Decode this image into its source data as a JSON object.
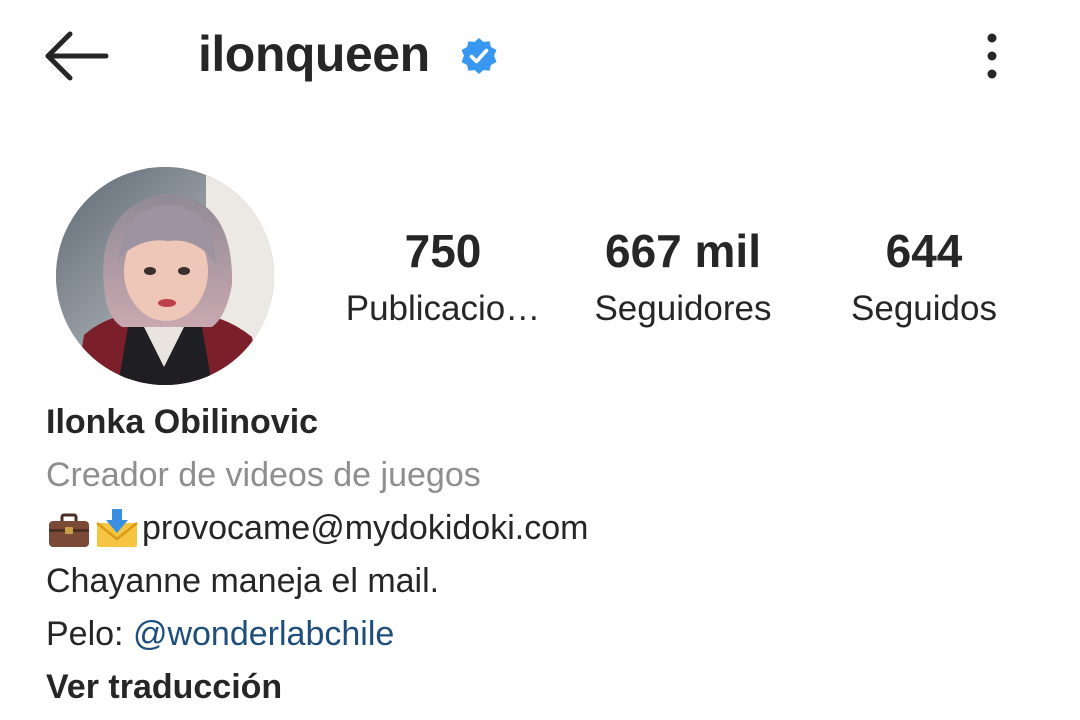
{
  "header": {
    "username": "ilonqueen",
    "back_icon": "arrow-left-icon",
    "verified_icon": "verified-badge-icon",
    "more_icon": "more-vertical-icon",
    "verified_color": "#3897f0"
  },
  "stats": [
    {
      "value": "750",
      "label": "Publicacio…"
    },
    {
      "value": "667 mil",
      "label": "Seguidores"
    },
    {
      "value": "644",
      "label": "Seguidos"
    }
  ],
  "bio": {
    "name": "Ilonka Obilinovic",
    "category": "Creador de videos de juegos",
    "email": "provocame@mydokidoki.com",
    "email_icons": [
      "briefcase-emoji",
      "incoming-envelope-emoji"
    ],
    "line_1": "Chayanne maneja el mail.",
    "hair_prefix": "Pelo: ",
    "hair_link": "@wonderlabchile",
    "translate": "Ver traducción"
  },
  "colors": {
    "text": "#262626",
    "secondary": "#8e8e8e",
    "link": "#1d4e7c"
  }
}
